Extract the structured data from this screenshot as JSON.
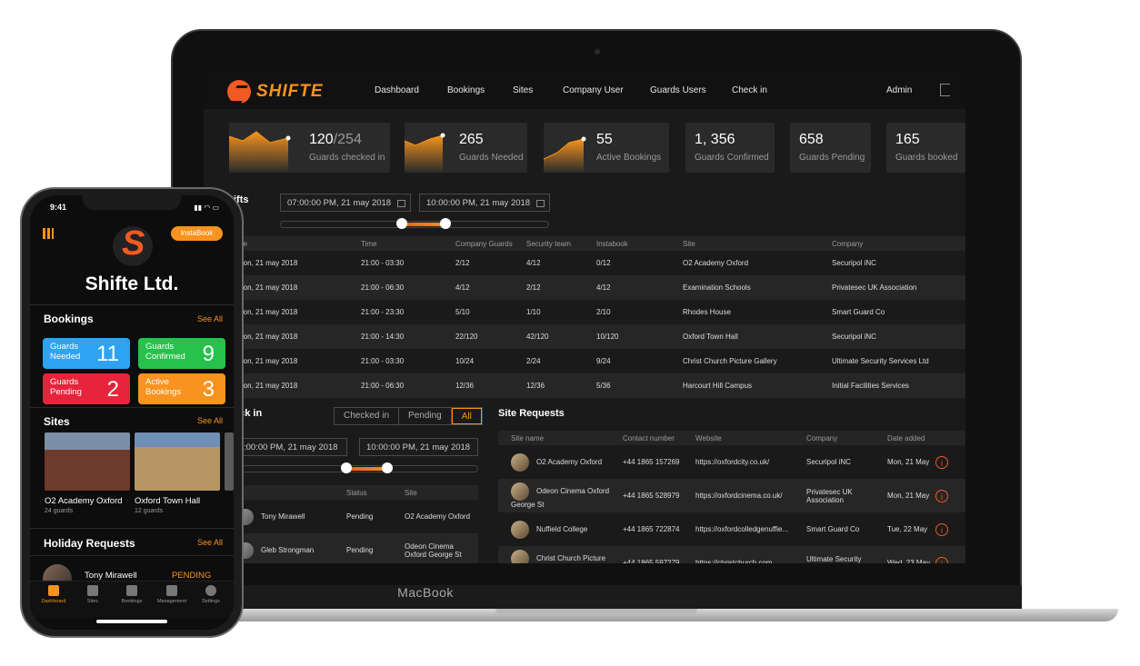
{
  "brand": "MacBook",
  "app": {
    "name": "SHIFTE"
  },
  "nav": {
    "items": [
      "Dashboard",
      "Bookings",
      "Sites",
      "Company User",
      "Guards Users",
      "Check in"
    ],
    "admin": "Admin"
  },
  "stats": [
    {
      "value": "120",
      "total": "/254",
      "label": "Guards checked in"
    },
    {
      "value": "265",
      "label": "Guards Needed"
    },
    {
      "value": "55",
      "label": "Active Bookings"
    },
    {
      "value": "1, 356",
      "label": "Guards Confirmed"
    },
    {
      "value": "658",
      "label": "Guards Pending"
    },
    {
      "value": "165",
      "label": "Guards booked"
    }
  ],
  "shifts": {
    "title": "ifts",
    "from": "07:00:00 PM,  21 may 2018",
    "to": "10:00:00 PM,  21 may 2018",
    "range": [
      0.45,
      0.61
    ],
    "columns": [
      "ate",
      "Time",
      "Company Guards",
      "Security team",
      "Instabook",
      "Site",
      "Company"
    ],
    "rows": [
      [
        "Mon, 21 may 2018",
        "21:00 - 03:30",
        "2/12",
        "4/12",
        "0/12",
        "O2 Academy Oxford",
        "Securipol iNC"
      ],
      [
        "Mon, 21 may 2018",
        "21:00 - 06:30",
        "4/12",
        "2/12",
        "4/12",
        "Examination Schools",
        "Privatesec UK Association"
      ],
      [
        "Mon, 21 may 2018",
        "21:00 - 23:30",
        "5/10",
        "1/10",
        "2/10",
        "Rhodes House",
        "Smart Guard Co"
      ],
      [
        "Mon, 21 may 2018",
        "21:00 - 14:30",
        "22/120",
        "42/120",
        "10/120",
        "Oxford Town Hall",
        "Securipol iNC"
      ],
      [
        "Mon, 21 may 2018",
        "21:00 - 03:30",
        "10/24",
        "2/24",
        "9/24",
        "Christ Church Picture Gallery",
        "Ultimate Security Services Ltd"
      ],
      [
        "Mon, 21 may 2018",
        "21:00 - 06:30",
        "12/36",
        "12/36",
        "5/36",
        "Harcourt Hill Campus",
        "Initial Facilities Services"
      ]
    ]
  },
  "checkin": {
    "title": "eck in",
    "filters": [
      "Checked in",
      "Pending",
      "All"
    ],
    "from": ":00:00 PM,  21 may 2018",
    "to": "10:00:00 PM,  21 may 2018",
    "range": [
      0.45,
      0.62
    ],
    "columns": [
      "er",
      "Status",
      "Site"
    ],
    "rows": [
      {
        "name": "Tony Mirawell",
        "status": "Pending",
        "site": "O2 Academy Oxford"
      },
      {
        "name": "Gleb Strongman",
        "status": "Pending",
        "site": "Odeon Cinema Oxford George St"
      }
    ]
  },
  "site_requests": {
    "title": "Site Requests",
    "columns": [
      "Site name",
      "Contact number",
      "Website",
      "Company",
      "Date added"
    ],
    "rows": [
      [
        "O2 Academy Oxford",
        "+44 1865 157269",
        "https://oxfordcity.co.uk/",
        "Securipol iNC",
        "Mon, 21 May"
      ],
      [
        "Odeon Cinema Oxford George St",
        "+44 1865 528979",
        "https://oxfordcinema.co.uk/",
        "Privatesec UK Association",
        "Mon, 21 May"
      ],
      [
        "Nuffield College",
        "+44 1865 722874",
        "https://oxfordcolledgenuffie...",
        "Smart Guard Co",
        "Tue, 22 May"
      ],
      [
        "Christ Church Picture Gallery",
        "+44 1865 597279",
        "https://christchurch.com",
        "Ultimate Security Services Ltd",
        "Wed, 23 May"
      ]
    ]
  },
  "phone": {
    "time": "9:41",
    "insta": "InstaBook",
    "company": "Shifte Ltd.",
    "bookings_title": "Bookings",
    "see_all": "See All",
    "tiles": [
      {
        "label": "Guards Needed",
        "value": "11",
        "color": "#2ea3f2"
      },
      {
        "label": "Guards Confirmed",
        "value": "9",
        "color": "#27c24c"
      },
      {
        "label": "Guards Pending",
        "value": "2",
        "color": "#e8243c"
      },
      {
        "label": "Active Bookings",
        "value": "3",
        "color": "#f7931e"
      }
    ],
    "sites_title": "Sites",
    "sites": [
      {
        "name": "O2 Academy Oxford",
        "sub": "24 guards"
      },
      {
        "name": "Oxford Town Hall",
        "sub": "12 guards"
      }
    ],
    "holiday_title": "Holiday Requests",
    "holiday": {
      "name": "Tony Mirawell",
      "status": "PENDING"
    },
    "tabs": [
      "Dashboard",
      "Sites",
      "Bookings",
      "Management",
      "Settings"
    ]
  }
}
